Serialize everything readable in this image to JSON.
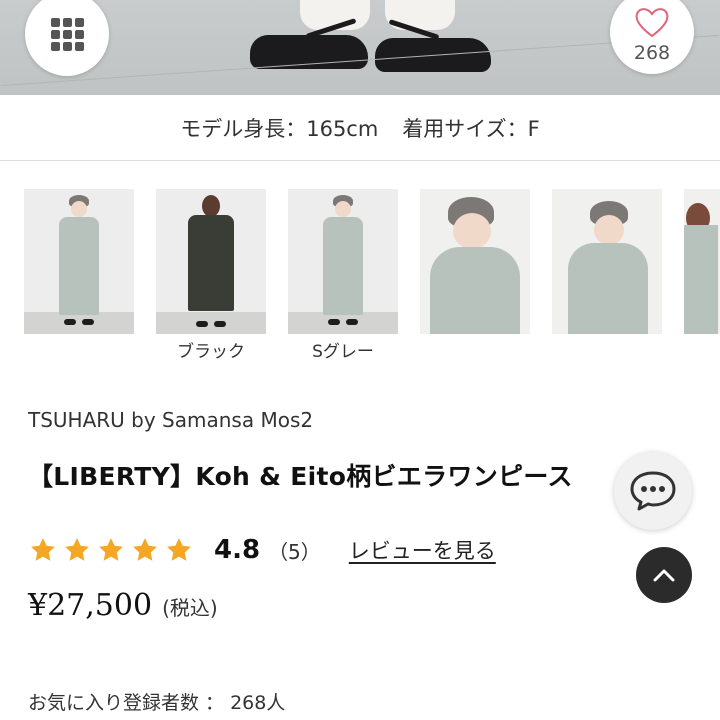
{
  "hero": {
    "favorite_count": "268",
    "icons": {
      "menu": "grid-icon",
      "favorite": "heart-icon"
    }
  },
  "model_info": {
    "height_label": "モデル身長：165cm",
    "size_label": "着用サイズ：F"
  },
  "thumbnails": [
    {
      "caption": "",
      "variant": "gray-full"
    },
    {
      "caption": "ブラック",
      "variant": "black-full"
    },
    {
      "caption": "Sグレー",
      "variant": "gray-full"
    },
    {
      "caption": "",
      "variant": "gray-closeup"
    },
    {
      "caption": "",
      "variant": "gray-closeup-arms"
    },
    {
      "caption": "",
      "variant": "partial"
    }
  ],
  "product": {
    "brand": "TSUHARU by Samansa Mos2",
    "title": "【LIBERTY】Koh & Eito柄ビエラワンピース",
    "rating": "4.8",
    "rating_count": "（5）",
    "rating_stars": 5,
    "review_link": "レビューを見る",
    "price": "¥27,500",
    "tax_label": "(税込)",
    "favorite_registrations": "お気に入り登録者数 ： 268人"
  },
  "colors": {
    "star": "#f5a623",
    "back_to_top_bg": "#2b2b2b"
  },
  "floating": {
    "chat_icon": "chat-bubble-icon",
    "top_icon": "chevron-up-icon"
  }
}
